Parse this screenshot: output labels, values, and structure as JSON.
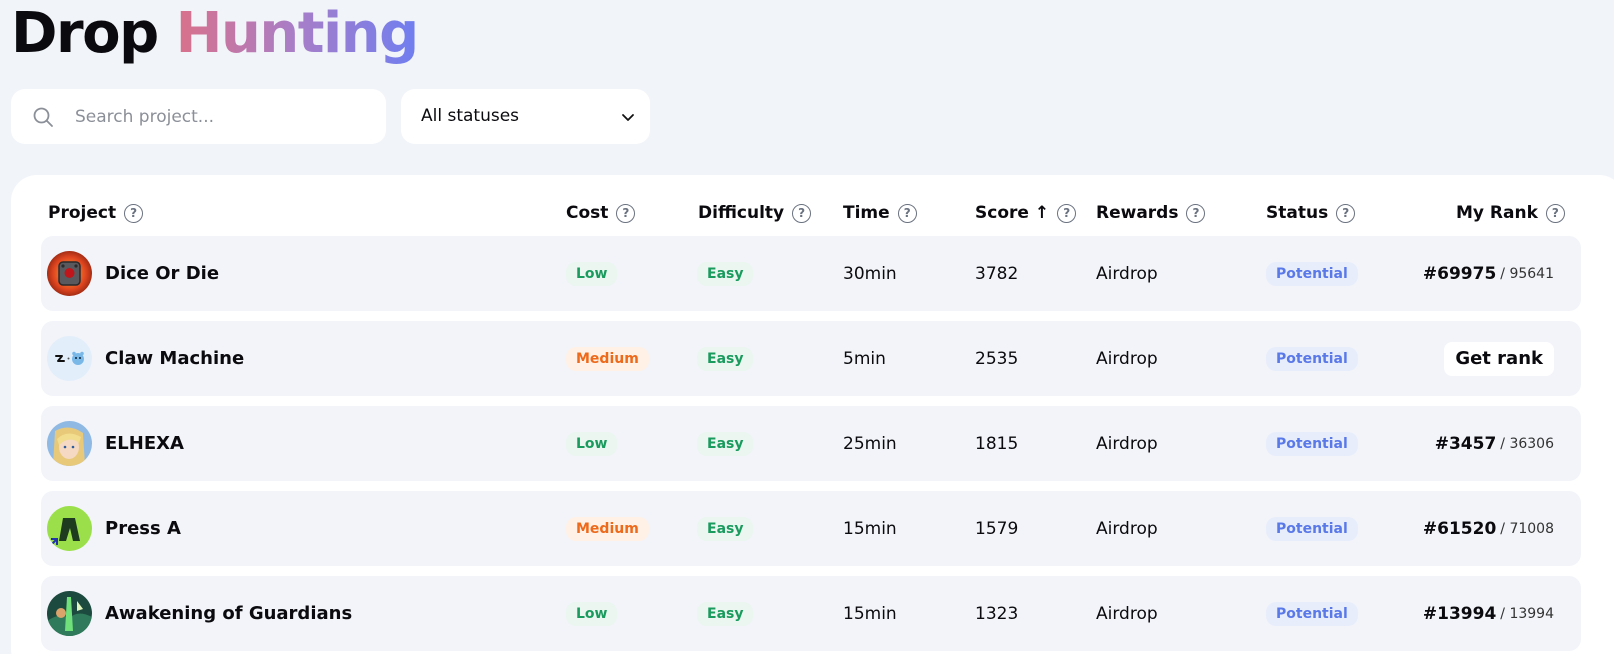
{
  "page": {
    "title_part1": "Drop",
    "title_part2": "Hunting"
  },
  "search": {
    "placeholder": "Search project...",
    "value": ""
  },
  "status_filter": {
    "selected": "All statuses"
  },
  "table": {
    "headers": {
      "project": "Project",
      "cost": "Cost",
      "difficulty": "Difficulty",
      "time": "Time",
      "score": "Score",
      "score_sort_arrow": "↑",
      "rewards": "Rewards",
      "status": "Status",
      "my_rank": "My Rank"
    },
    "help_glyph": "?",
    "rows": [
      {
        "name": "Dice Or Die",
        "cost": "Low",
        "difficulty": "Easy",
        "time": "30min",
        "score": "3782",
        "rewards": "Airdrop",
        "status": "Potential",
        "rank": "#69975",
        "rank_total": "/ 95641",
        "avatar_icon": "dice-avatar-icon"
      },
      {
        "name": "Claw Machine",
        "cost": "Medium",
        "difficulty": "Easy",
        "time": "5min",
        "score": "2535",
        "rewards": "Airdrop",
        "status": "Potential",
        "rank_button": "Get rank",
        "avatar_icon": "claw-machine-avatar-icon"
      },
      {
        "name": "ELHEXA",
        "cost": "Low",
        "difficulty": "Easy",
        "time": "25min",
        "score": "1815",
        "rewards": "Airdrop",
        "status": "Potential",
        "rank": "#3457",
        "rank_total": "/ 36306",
        "avatar_icon": "elf-avatar-icon"
      },
      {
        "name": "Press A",
        "cost": "Medium",
        "difficulty": "Easy",
        "time": "15min",
        "score": "1579",
        "rewards": "Airdrop",
        "status": "Potential",
        "rank": "#61520",
        "rank_total": "/ 71008",
        "avatar_icon": "press-a-logo-icon"
      },
      {
        "name": "Awakening of Guardians",
        "cost": "Low",
        "difficulty": "Easy",
        "time": "15min",
        "score": "1323",
        "rewards": "Airdrop",
        "status": "Potential",
        "rank": "#13994",
        "rank_total": "/ 13994",
        "avatar_icon": "guardian-avatar-icon"
      }
    ]
  },
  "colors": {
    "background": "#f1f4f9",
    "title_gradient_start": "#d9718a",
    "title_gradient_end": "#6f7ef0",
    "cost_low": "#1a9b5e",
    "cost_medium": "#ee6a1b",
    "status_potential": "#5a79e8"
  }
}
